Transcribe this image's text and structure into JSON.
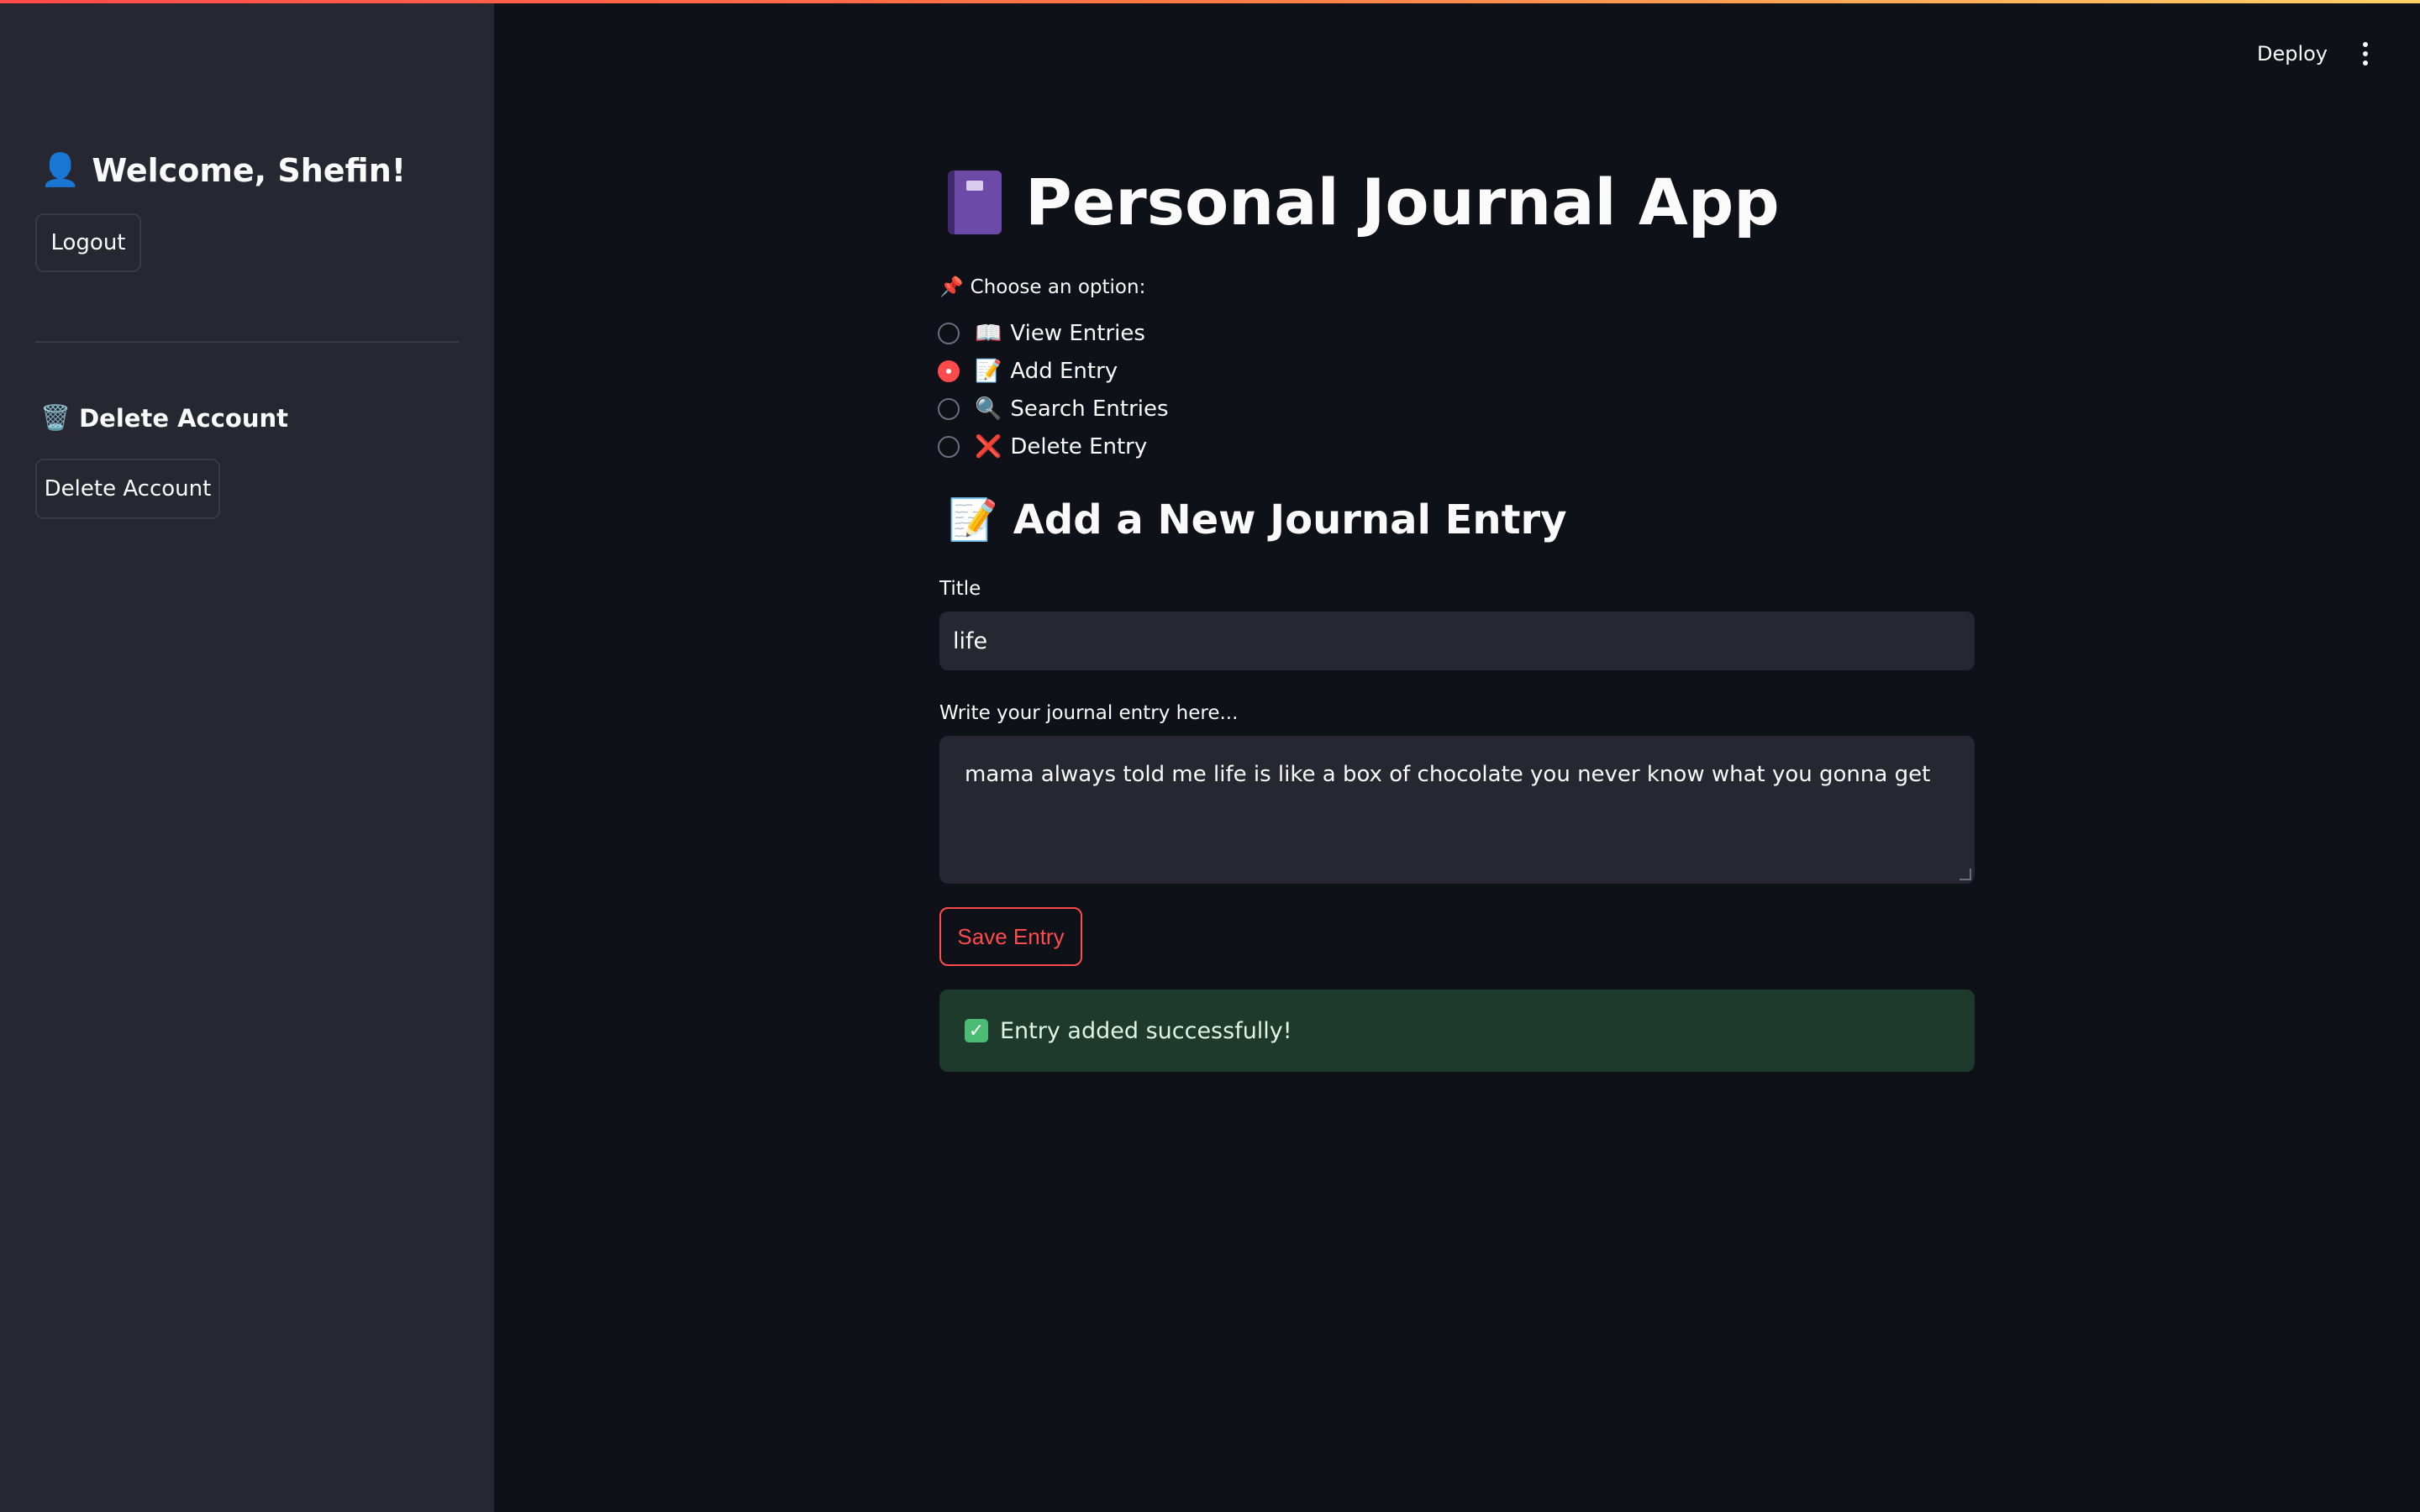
{
  "toolbar": {
    "deploy_label": "Deploy",
    "menu_icon": "more-vertical-icon"
  },
  "sidebar": {
    "welcome_icon": "👤",
    "welcome_text": "Welcome, Shefin!",
    "logout_label": "Logout",
    "delete_heading_icon": "🗑️",
    "delete_heading_text": "Delete Account",
    "delete_button_label": "Delete Account"
  },
  "main": {
    "title_text": "Personal Journal App",
    "title_icon": "notebook-icon",
    "radio_label_icon": "📌",
    "radio_label_text": "Choose an option:",
    "options": [
      {
        "icon": "📖",
        "label": "View Entries",
        "selected": false
      },
      {
        "icon": "📝",
        "label": "Add Entry",
        "selected": true
      },
      {
        "icon": "🔍",
        "label": "Search Entries",
        "selected": false
      },
      {
        "icon": "❌",
        "label": "Delete Entry",
        "selected": false
      }
    ],
    "section_icon": "📝",
    "section_heading": "Add a New Journal Entry",
    "title_field_label": "Title",
    "title_field_value": "life",
    "entry_field_label": "Write your journal entry here...",
    "entry_field_value": "mama always told me life is like a box of chocolate you never know what you gonna get",
    "save_label": "Save Entry",
    "success_icon": "✓",
    "success_text": "Entry added successfully!"
  },
  "colors": {
    "background": "#0e1117",
    "sidebar": "#262730",
    "accent": "#ff4b4b",
    "success_bg": "#1e3a2c"
  }
}
